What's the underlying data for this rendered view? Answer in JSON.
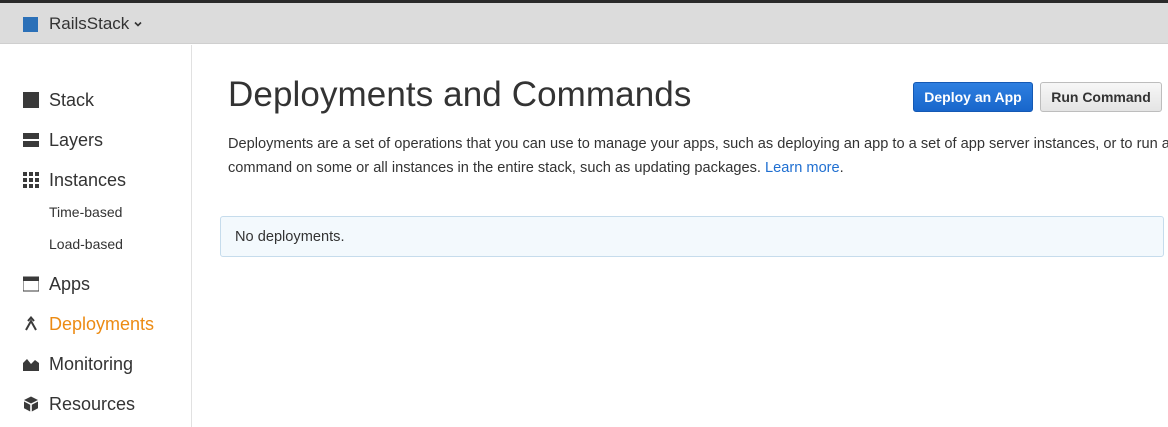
{
  "header": {
    "stack_name": "RailsStack"
  },
  "sidebar": {
    "items": [
      {
        "label": "Stack",
        "icon": "stack-icon"
      },
      {
        "label": "Layers",
        "icon": "layers-icon"
      },
      {
        "label": "Instances",
        "icon": "instances-icon",
        "sub_items": [
          "Time-based",
          "Load-based"
        ]
      },
      {
        "label": "Apps",
        "icon": "apps-icon"
      },
      {
        "label": "Deployments",
        "icon": "deployments-icon",
        "active": true
      },
      {
        "label": "Monitoring",
        "icon": "monitoring-icon"
      },
      {
        "label": "Resources",
        "icon": "resources-icon"
      }
    ]
  },
  "main": {
    "title": "Deployments and Commands",
    "deploy_button": "Deploy an App",
    "run_button": "Run Command",
    "description": "Deployments are a set of operations that you can use to manage your apps, such as deploying an app to a set of app server instances, or to run a command on some or all instances in the entire stack, such as updating packages.",
    "learn_more": "Learn more",
    "description_end": ".",
    "empty_message": "No deployments."
  },
  "colors": {
    "accent": "#ec8b13",
    "primary_button": "#1f6fd1",
    "stack_square": "#2b70b8",
    "link": "#1f6fd1",
    "empty_box_bg": "#f3f9fd"
  }
}
